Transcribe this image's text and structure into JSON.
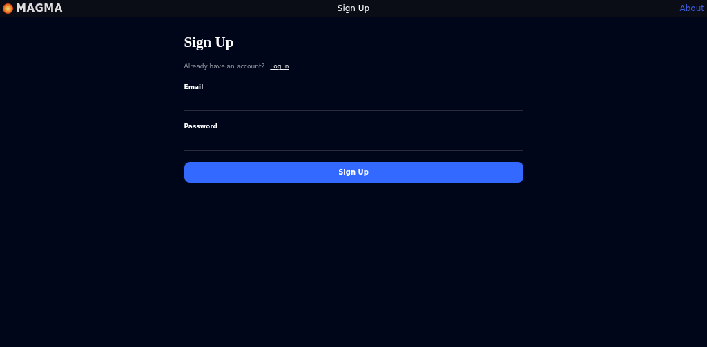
{
  "header": {
    "brand": "MAGMA",
    "title": "Sign Up",
    "link": "About"
  },
  "form": {
    "heading": "Sign Up",
    "prompt": "Already have an account?",
    "login_link": "Log In",
    "fields": [
      {
        "label": "Email"
      },
      {
        "label": "Password"
      }
    ],
    "submit": "Sign Up"
  }
}
